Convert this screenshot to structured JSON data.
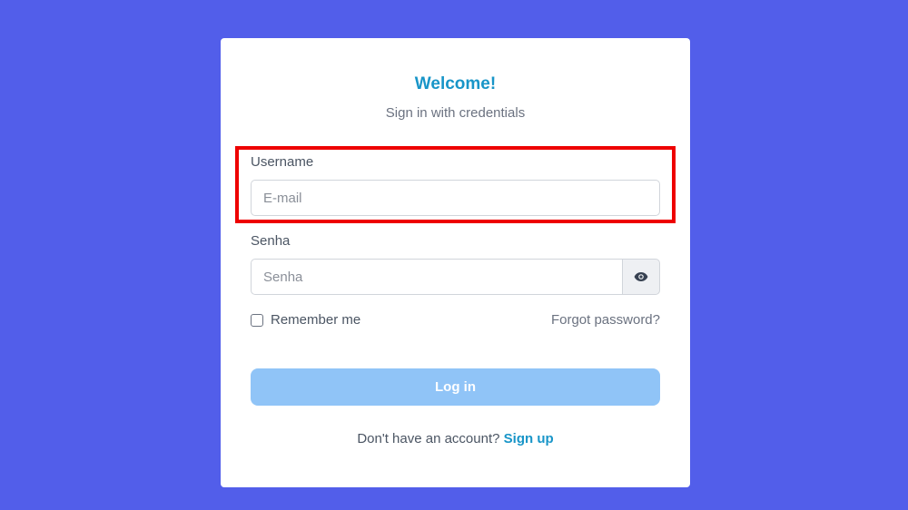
{
  "card": {
    "title": "Welcome!",
    "subtitle": "Sign in with credentials"
  },
  "form": {
    "username_label": "Username",
    "username_placeholder": "E-mail",
    "password_label": "Senha",
    "password_placeholder": "Senha",
    "password_toggle_icon": "eye-icon",
    "remember_label": "Remember me",
    "remember_checked": false,
    "forgot_label": "Forgot password?",
    "login_label": "Log in"
  },
  "signup": {
    "prompt": "Don't have an account?",
    "link_label": "Sign up"
  },
  "colors": {
    "background": "#525eea",
    "accent": "#1895c8",
    "login_button": "#90c4f7",
    "highlight": "#ee0000"
  }
}
